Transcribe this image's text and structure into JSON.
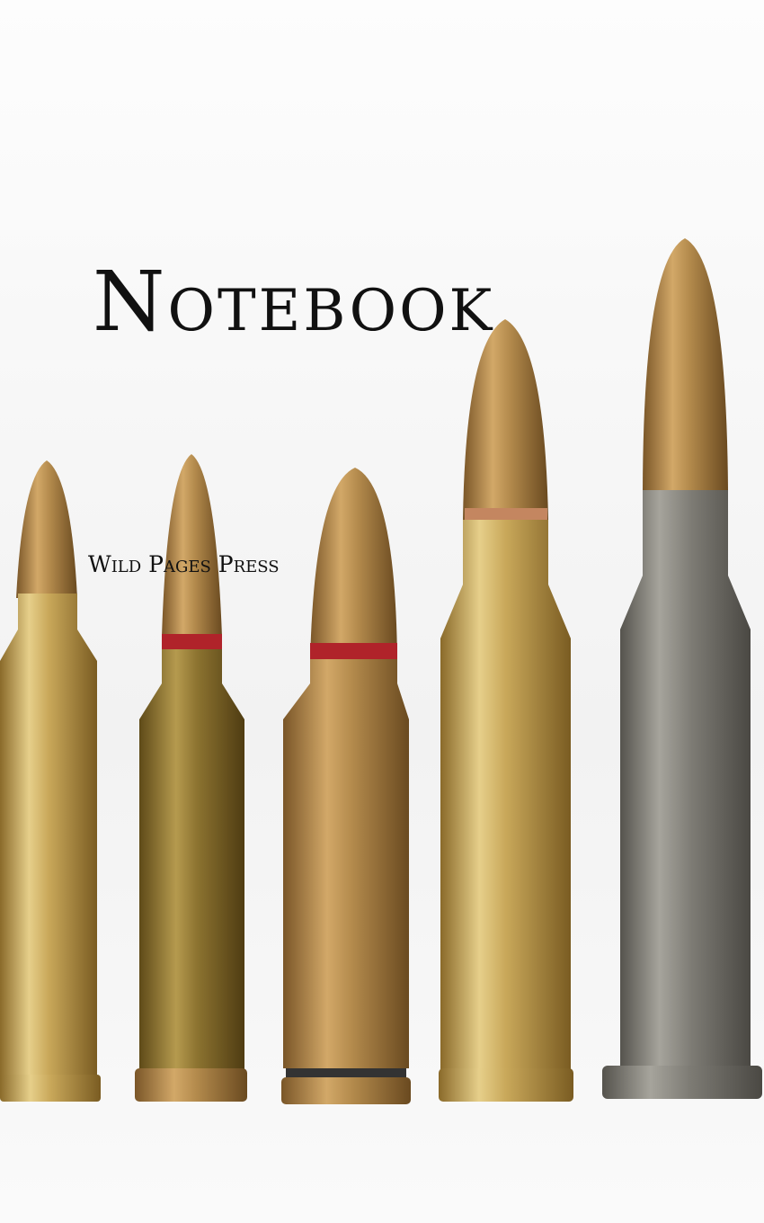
{
  "cover": {
    "title": "Notebook",
    "publisher": "Wild Pages Press"
  },
  "colors": {
    "background": "#f7f7f7",
    "brass": "#c9a85a",
    "copper": "#b38a4c",
    "steel": "#7d7b74",
    "sealant_red": "#b0232a"
  }
}
